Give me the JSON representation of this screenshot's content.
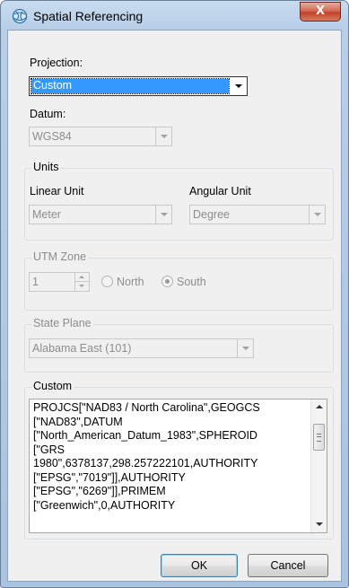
{
  "window": {
    "title": "Spatial Referencing",
    "title_icon": "globe-icon",
    "close_label": "X"
  },
  "projection": {
    "label": "Projection:",
    "selected": "Custom"
  },
  "datum": {
    "label": "Datum:",
    "selected": "WGS84"
  },
  "units": {
    "title": "Units",
    "linear_label": "Linear Unit",
    "linear_value": "Meter",
    "angular_label": "Angular Unit",
    "angular_value": "Degree"
  },
  "utm": {
    "title": "UTM Zone",
    "zone_value": "1",
    "north_label": "North",
    "south_label": "South",
    "selected": "South"
  },
  "state_plane": {
    "title": "State Plane",
    "selected": "Alabama East (101)"
  },
  "custom": {
    "title": "Custom",
    "text": "PROJCS[\"NAD83 / North Carolina\",GEOGCS\n[\"NAD83\",DATUM\n[\"North_American_Datum_1983\",SPHEROID\n[\"GRS\n1980\",6378137,298.257222101,AUTHORITY\n[\"EPSG\",\"7019\"]],AUTHORITY\n[\"EPSG\",\"6269\"]],PRIMEM\n[\"Greenwich\",0,AUTHORITY"
  },
  "buttons": {
    "ok": "OK",
    "cancel": "Cancel"
  },
  "colors": {
    "titlebar": "#b8cfe8",
    "selection": "#3399ff",
    "close_button": "#c0432b"
  }
}
